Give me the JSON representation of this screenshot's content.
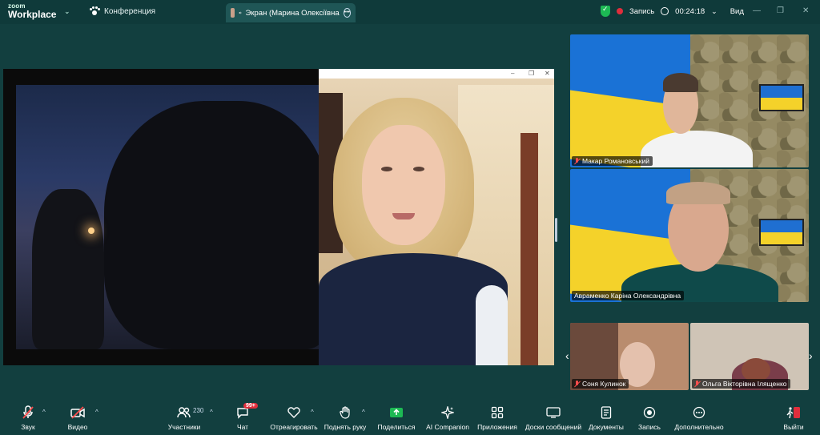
{
  "app": {
    "logo_top": "zoom",
    "logo_bottom": "Workplace",
    "meeting_label": "Конференция"
  },
  "screen_tab": {
    "label": "Экран (Марина Олексіївна"
  },
  "recording": {
    "record_label": "Запись",
    "timer": "00:24:18",
    "view_label": "Вид"
  },
  "participants": [
    {
      "name": "Макар Романовський"
    },
    {
      "name": "Авраменко Каріна Олександрівна"
    },
    {
      "name": "Соня Кулинок"
    },
    {
      "name": "Ольга Вікторівна Ілященко"
    }
  ],
  "toolbar": {
    "audio": "Звук",
    "video": "Видео",
    "participants": "Участники",
    "participants_count": "230",
    "chat": "Чат",
    "chat_badge": "99+",
    "react": "Отреагировать",
    "raise_hand": "Поднять руку",
    "share": "Поделиться",
    "ai": "AI Companion",
    "apps": "Приложения",
    "whiteboards": "Доски сообщений",
    "docs": "Документы",
    "record": "Запись",
    "more": "Дополнительно",
    "leave": "Выйти"
  },
  "colors": {
    "background": "#123f3f",
    "accent_green": "#1db954",
    "record_red": "#e02e3c"
  }
}
